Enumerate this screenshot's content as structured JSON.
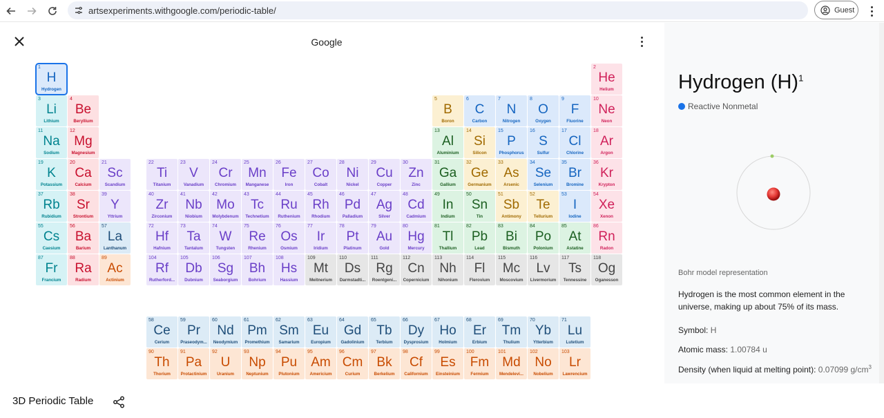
{
  "browser": {
    "url": "artsexperiments.withgoogle.com/periodic-table/",
    "profile_label": "Guest",
    "icons": [
      "back-icon",
      "forward-icon",
      "reload-icon",
      "site-info-icon",
      "profile-icon",
      "more-vert-icon"
    ]
  },
  "app": {
    "brand": "Google",
    "footer_title": "3D Periodic Table",
    "icons": [
      "close-icon",
      "more-vert-icon",
      "share-icon"
    ]
  },
  "colors": {
    "accent": "#1a73e8",
    "categories": {
      "reactive": {
        "bg": "#dbe9fb",
        "fg": "#1565c0"
      },
      "noble": {
        "bg": "#fde2e8",
        "fg": "#d0215a"
      },
      "alkali": {
        "bg": "#d5f2f5",
        "fg": "#00838f"
      },
      "alkaline": {
        "bg": "#fde0e2",
        "fg": "#c8102e"
      },
      "transition": {
        "bg": "#ece6fb",
        "fg": "#6a3fc8"
      },
      "posttransition": {
        "bg": "#dcf3e2",
        "fg": "#1b5e20"
      },
      "metalloid": {
        "bg": "#fcf0d2",
        "fg": "#a06a00"
      },
      "unknown": {
        "bg": "#e6e6e6",
        "fg": "#444444"
      },
      "lanthanide": {
        "bg": "#dcebf6",
        "fg": "#1f4e79"
      },
      "actinide": {
        "bg": "#fde6d4",
        "fg": "#c84b00"
      }
    }
  },
  "elements": [
    {
      "n": "1",
      "s": "H",
      "name": "Hydrogen",
      "c": "reactive",
      "r": 1,
      "g": 1
    },
    {
      "n": "2",
      "s": "He",
      "name": "Helium",
      "c": "noble",
      "r": 1,
      "g": 18
    },
    {
      "n": "3",
      "s": "Li",
      "name": "Lithium",
      "c": "alkali",
      "r": 2,
      "g": 1
    },
    {
      "n": "4",
      "s": "Be",
      "name": "Beryllium",
      "c": "alkaline",
      "r": 2,
      "g": 2
    },
    {
      "n": "5",
      "s": "B",
      "name": "Boron",
      "c": "metalloid",
      "r": 2,
      "g": 13
    },
    {
      "n": "6",
      "s": "C",
      "name": "Carbon",
      "c": "reactive",
      "r": 2,
      "g": 14
    },
    {
      "n": "7",
      "s": "N",
      "name": "Nitrogen",
      "c": "reactive",
      "r": 2,
      "g": 15
    },
    {
      "n": "8",
      "s": "O",
      "name": "Oxygen",
      "c": "reactive",
      "r": 2,
      "g": 16
    },
    {
      "n": "9",
      "s": "F",
      "name": "Fluorine",
      "c": "reactive",
      "r": 2,
      "g": 17
    },
    {
      "n": "10",
      "s": "Ne",
      "name": "Neon",
      "c": "noble",
      "r": 2,
      "g": 18
    },
    {
      "n": "11",
      "s": "Na",
      "name": "Sodium",
      "c": "alkali",
      "r": 3,
      "g": 1
    },
    {
      "n": "12",
      "s": "Mg",
      "name": "Magnesium",
      "c": "alkaline",
      "r": 3,
      "g": 2
    },
    {
      "n": "13",
      "s": "Al",
      "name": "Aluminium",
      "c": "posttransition",
      "r": 3,
      "g": 13
    },
    {
      "n": "14",
      "s": "Si",
      "name": "Silicon",
      "c": "metalloid",
      "r": 3,
      "g": 14
    },
    {
      "n": "15",
      "s": "P",
      "name": "Phosphorus",
      "c": "reactive",
      "r": 3,
      "g": 15
    },
    {
      "n": "16",
      "s": "S",
      "name": "Sulfur",
      "c": "reactive",
      "r": 3,
      "g": 16
    },
    {
      "n": "17",
      "s": "Cl",
      "name": "Chlorine",
      "c": "reactive",
      "r": 3,
      "g": 17
    },
    {
      "n": "18",
      "s": "Ar",
      "name": "Argon",
      "c": "noble",
      "r": 3,
      "g": 18
    },
    {
      "n": "19",
      "s": "K",
      "name": "Potassium",
      "c": "alkali",
      "r": 4,
      "g": 1
    },
    {
      "n": "20",
      "s": "Ca",
      "name": "Calcium",
      "c": "alkaline",
      "r": 4,
      "g": 2
    },
    {
      "n": "21",
      "s": "Sc",
      "name": "Scandium",
      "c": "transition",
      "r": 4,
      "g": 3
    },
    {
      "n": "22",
      "s": "Ti",
      "name": "Titanium",
      "c": "transition",
      "r": 4,
      "g": 4
    },
    {
      "n": "23",
      "s": "V",
      "name": "Vanadium",
      "c": "transition",
      "r": 4,
      "g": 5
    },
    {
      "n": "24",
      "s": "Cr",
      "name": "Chromium",
      "c": "transition",
      "r": 4,
      "g": 6
    },
    {
      "n": "25",
      "s": "Mn",
      "name": "Manganese",
      "c": "transition",
      "r": 4,
      "g": 7
    },
    {
      "n": "26",
      "s": "Fe",
      "name": "Iron",
      "c": "transition",
      "r": 4,
      "g": 8
    },
    {
      "n": "27",
      "s": "Co",
      "name": "Cobalt",
      "c": "transition",
      "r": 4,
      "g": 9
    },
    {
      "n": "28",
      "s": "Ni",
      "name": "Nickel",
      "c": "transition",
      "r": 4,
      "g": 10
    },
    {
      "n": "29",
      "s": "Cu",
      "name": "Copper",
      "c": "transition",
      "r": 4,
      "g": 11
    },
    {
      "n": "30",
      "s": "Zn",
      "name": "Zinc",
      "c": "transition",
      "r": 4,
      "g": 12
    },
    {
      "n": "31",
      "s": "Ga",
      "name": "Gallium",
      "c": "posttransition",
      "r": 4,
      "g": 13
    },
    {
      "n": "32",
      "s": "Ge",
      "name": "Germanium",
      "c": "metalloid",
      "r": 4,
      "g": 14
    },
    {
      "n": "33",
      "s": "As",
      "name": "Arsenic",
      "c": "metalloid",
      "r": 4,
      "g": 15
    },
    {
      "n": "34",
      "s": "Se",
      "name": "Selenium",
      "c": "reactive",
      "r": 4,
      "g": 16
    },
    {
      "n": "35",
      "s": "Br",
      "name": "Bromine",
      "c": "reactive",
      "r": 4,
      "g": 17
    },
    {
      "n": "36",
      "s": "Kr",
      "name": "Krypton",
      "c": "noble",
      "r": 4,
      "g": 18
    },
    {
      "n": "37",
      "s": "Rb",
      "name": "Rubidium",
      "c": "alkali",
      "r": 5,
      "g": 1
    },
    {
      "n": "38",
      "s": "Sr",
      "name": "Strontium",
      "c": "alkaline",
      "r": 5,
      "g": 2
    },
    {
      "n": "39",
      "s": "Y",
      "name": "Yttrium",
      "c": "transition",
      "r": 5,
      "g": 3
    },
    {
      "n": "40",
      "s": "Zr",
      "name": "Zirconium",
      "c": "transition",
      "r": 5,
      "g": 4
    },
    {
      "n": "41",
      "s": "Nb",
      "name": "Niobium",
      "c": "transition",
      "r": 5,
      "g": 5
    },
    {
      "n": "42",
      "s": "Mo",
      "name": "Molybdenum",
      "c": "transition",
      "r": 5,
      "g": 6
    },
    {
      "n": "43",
      "s": "Tc",
      "name": "Technetium",
      "c": "transition",
      "r": 5,
      "g": 7
    },
    {
      "n": "44",
      "s": "Ru",
      "name": "Ruthenium",
      "c": "transition",
      "r": 5,
      "g": 8
    },
    {
      "n": "45",
      "s": "Rh",
      "name": "Rhodium",
      "c": "transition",
      "r": 5,
      "g": 9
    },
    {
      "n": "46",
      "s": "Pd",
      "name": "Palladium",
      "c": "transition",
      "r": 5,
      "g": 10
    },
    {
      "n": "47",
      "s": "Ag",
      "name": "Silver",
      "c": "transition",
      "r": 5,
      "g": 11
    },
    {
      "n": "48",
      "s": "Cd",
      "name": "Cadmium",
      "c": "transition",
      "r": 5,
      "g": 12
    },
    {
      "n": "49",
      "s": "In",
      "name": "Indium",
      "c": "posttransition",
      "r": 5,
      "g": 13
    },
    {
      "n": "50",
      "s": "Sn",
      "name": "Tin",
      "c": "posttransition",
      "r": 5,
      "g": 14
    },
    {
      "n": "51",
      "s": "Sb",
      "name": "Antimony",
      "c": "metalloid",
      "r": 5,
      "g": 15
    },
    {
      "n": "52",
      "s": "Te",
      "name": "Tellurium",
      "c": "metalloid",
      "r": 5,
      "g": 16
    },
    {
      "n": "53",
      "s": "I",
      "name": "Iodine",
      "c": "reactive",
      "r": 5,
      "g": 17
    },
    {
      "n": "54",
      "s": "Xe",
      "name": "Xenon",
      "c": "noble",
      "r": 5,
      "g": 18
    },
    {
      "n": "55",
      "s": "Cs",
      "name": "Caesium",
      "c": "alkali",
      "r": 6,
      "g": 1
    },
    {
      "n": "56",
      "s": "Ba",
      "name": "Barium",
      "c": "alkaline",
      "r": 6,
      "g": 2
    },
    {
      "n": "57",
      "s": "La",
      "name": "Lanthanum",
      "c": "lanthanide",
      "r": 6,
      "g": 3
    },
    {
      "n": "72",
      "s": "Hf",
      "name": "Hafnium",
      "c": "transition",
      "r": 6,
      "g": 4
    },
    {
      "n": "73",
      "s": "Ta",
      "name": "Tantalum",
      "c": "transition",
      "r": 6,
      "g": 5
    },
    {
      "n": "74",
      "s": "W",
      "name": "Tungsten",
      "c": "transition",
      "r": 6,
      "g": 6
    },
    {
      "n": "75",
      "s": "Re",
      "name": "Rhenium",
      "c": "transition",
      "r": 6,
      "g": 7
    },
    {
      "n": "76",
      "s": "Os",
      "name": "Osmium",
      "c": "transition",
      "r": 6,
      "g": 8
    },
    {
      "n": "77",
      "s": "Ir",
      "name": "Iridium",
      "c": "transition",
      "r": 6,
      "g": 9
    },
    {
      "n": "78",
      "s": "Pt",
      "name": "Platinum",
      "c": "transition",
      "r": 6,
      "g": 10
    },
    {
      "n": "79",
      "s": "Au",
      "name": "Gold",
      "c": "transition",
      "r": 6,
      "g": 11
    },
    {
      "n": "80",
      "s": "Hg",
      "name": "Mercury",
      "c": "transition",
      "r": 6,
      "g": 12
    },
    {
      "n": "81",
      "s": "Tl",
      "name": "Thallium",
      "c": "posttransition",
      "r": 6,
      "g": 13
    },
    {
      "n": "82",
      "s": "Pb",
      "name": "Lead",
      "c": "posttransition",
      "r": 6,
      "g": 14
    },
    {
      "n": "83",
      "s": "Bi",
      "name": "Bismuth",
      "c": "posttransition",
      "r": 6,
      "g": 15
    },
    {
      "n": "84",
      "s": "Po",
      "name": "Polonium",
      "c": "posttransition",
      "r": 6,
      "g": 16
    },
    {
      "n": "85",
      "s": "At",
      "name": "Astatine",
      "c": "posttransition",
      "r": 6,
      "g": 17
    },
    {
      "n": "86",
      "s": "Rn",
      "name": "Radon",
      "c": "noble",
      "r": 6,
      "g": 18
    },
    {
      "n": "87",
      "s": "Fr",
      "name": "Francium",
      "c": "alkali",
      "r": 7,
      "g": 1
    },
    {
      "n": "88",
      "s": "Ra",
      "name": "Radium",
      "c": "alkaline",
      "r": 7,
      "g": 2
    },
    {
      "n": "89",
      "s": "Ac",
      "name": "Actinium",
      "c": "actinide",
      "r": 7,
      "g": 3
    },
    {
      "n": "104",
      "s": "Rf",
      "name": "Rutherford...",
      "c": "transition",
      "r": 7,
      "g": 4
    },
    {
      "n": "105",
      "s": "Db",
      "name": "Dubnium",
      "c": "transition",
      "r": 7,
      "g": 5
    },
    {
      "n": "106",
      "s": "Sg",
      "name": "Seaborgium",
      "c": "transition",
      "r": 7,
      "g": 6
    },
    {
      "n": "107",
      "s": "Bh",
      "name": "Bohrium",
      "c": "transition",
      "r": 7,
      "g": 7
    },
    {
      "n": "108",
      "s": "Hs",
      "name": "Hassium",
      "c": "transition",
      "r": 7,
      "g": 8
    },
    {
      "n": "109",
      "s": "Mt",
      "name": "Meitnerium",
      "c": "unknown",
      "r": 7,
      "g": 9
    },
    {
      "n": "110",
      "s": "Ds",
      "name": "Darmstadti...",
      "c": "unknown",
      "r": 7,
      "g": 10
    },
    {
      "n": "111",
      "s": "Rg",
      "name": "Roentgeni...",
      "c": "unknown",
      "r": 7,
      "g": 11
    },
    {
      "n": "112",
      "s": "Cn",
      "name": "Copernicium",
      "c": "unknown",
      "r": 7,
      "g": 12
    },
    {
      "n": "113",
      "s": "Nh",
      "name": "Nihonium",
      "c": "unknown",
      "r": 7,
      "g": 13
    },
    {
      "n": "114",
      "s": "Fl",
      "name": "Flerovium",
      "c": "unknown",
      "r": 7,
      "g": 14
    },
    {
      "n": "115",
      "s": "Mc",
      "name": "Moscovium",
      "c": "unknown",
      "r": 7,
      "g": 15
    },
    {
      "n": "116",
      "s": "Lv",
      "name": "Livermorium",
      "c": "unknown",
      "r": 7,
      "g": 16
    },
    {
      "n": "117",
      "s": "Ts",
      "name": "Tennessine",
      "c": "unknown",
      "r": 7,
      "g": 17
    },
    {
      "n": "118",
      "s": "Og",
      "name": "Oganesson",
      "c": "unknown",
      "r": 7,
      "g": 18
    },
    {
      "n": "58",
      "s": "Ce",
      "name": "Cerium",
      "c": "lanthanide",
      "r": 9,
      "g": 4
    },
    {
      "n": "59",
      "s": "Pr",
      "name": "Praseodym...",
      "c": "lanthanide",
      "r": 9,
      "g": 5
    },
    {
      "n": "60",
      "s": "Nd",
      "name": "Neodymium",
      "c": "lanthanide",
      "r": 9,
      "g": 6
    },
    {
      "n": "61",
      "s": "Pm",
      "name": "Promethium",
      "c": "lanthanide",
      "r": 9,
      "g": 7
    },
    {
      "n": "62",
      "s": "Sm",
      "name": "Samarium",
      "c": "lanthanide",
      "r": 9,
      "g": 8
    },
    {
      "n": "63",
      "s": "Eu",
      "name": "Europium",
      "c": "lanthanide",
      "r": 9,
      "g": 9
    },
    {
      "n": "64",
      "s": "Gd",
      "name": "Gadolinium",
      "c": "lanthanide",
      "r": 9,
      "g": 10
    },
    {
      "n": "65",
      "s": "Tb",
      "name": "Terbium",
      "c": "lanthanide",
      "r": 9,
      "g": 11
    },
    {
      "n": "66",
      "s": "Dy",
      "name": "Dysprosium",
      "c": "lanthanide",
      "r": 9,
      "g": 12
    },
    {
      "n": "67",
      "s": "Ho",
      "name": "Holmium",
      "c": "lanthanide",
      "r": 9,
      "g": 13
    },
    {
      "n": "68",
      "s": "Er",
      "name": "Erbium",
      "c": "lanthanide",
      "r": 9,
      "g": 14
    },
    {
      "n": "69",
      "s": "Tm",
      "name": "Thulium",
      "c": "lanthanide",
      "r": 9,
      "g": 15
    },
    {
      "n": "70",
      "s": "Yb",
      "name": "Ytterbium",
      "c": "lanthanide",
      "r": 9,
      "g": 16
    },
    {
      "n": "71",
      "s": "Lu",
      "name": "Lutetium",
      "c": "lanthanide",
      "r": 9,
      "g": 17
    },
    {
      "n": "90",
      "s": "Th",
      "name": "Thorium",
      "c": "actinide",
      "r": 10,
      "g": 4
    },
    {
      "n": "91",
      "s": "Pa",
      "name": "Protactinium",
      "c": "actinide",
      "r": 10,
      "g": 5
    },
    {
      "n": "92",
      "s": "U",
      "name": "Uranium",
      "c": "actinide",
      "r": 10,
      "g": 6
    },
    {
      "n": "93",
      "s": "Np",
      "name": "Neptunium",
      "c": "actinide",
      "r": 10,
      "g": 7
    },
    {
      "n": "94",
      "s": "Pu",
      "name": "Plutonium",
      "c": "actinide",
      "r": 10,
      "g": 8
    },
    {
      "n": "95",
      "s": "Am",
      "name": "Americium",
      "c": "actinide",
      "r": 10,
      "g": 9
    },
    {
      "n": "96",
      "s": "Cm",
      "name": "Curium",
      "c": "actinide",
      "r": 10,
      "g": 10
    },
    {
      "n": "97",
      "s": "Bk",
      "name": "Berkelium",
      "c": "actinide",
      "r": 10,
      "g": 11
    },
    {
      "n": "98",
      "s": "Cf",
      "name": "Californium",
      "c": "actinide",
      "r": 10,
      "g": 12
    },
    {
      "n": "99",
      "s": "Es",
      "name": "Einsteinium",
      "c": "actinide",
      "r": 10,
      "g": 13
    },
    {
      "n": "100",
      "s": "Fm",
      "name": "Fermium",
      "c": "actinide",
      "r": 10,
      "g": 14
    },
    {
      "n": "101",
      "s": "Md",
      "name": "Mendelevi...",
      "c": "actinide",
      "r": 10,
      "g": 15
    },
    {
      "n": "102",
      "s": "No",
      "name": "Nobelium",
      "c": "actinide",
      "r": 10,
      "g": 16
    },
    {
      "n": "103",
      "s": "Lr",
      "name": "Lawrencium",
      "c": "actinide",
      "r": 10,
      "g": 17
    }
  ],
  "selected": {
    "symbol_index": "1",
    "title": "Hydrogen (H)",
    "atomic_number": "1",
    "category": "Reactive Nonmetal",
    "bohr_caption": "Bohr model representation",
    "description": "Hydrogen is the most common element in the universe, making up about 75% of its mass.",
    "symbol_label": "Symbol:",
    "symbol_value": "H",
    "mass_label": "Atomic mass:",
    "mass_value": "1.00784 u",
    "density_label": "Density (when liquid at melting point):",
    "density_value": "0.07099 g/cm",
    "density_unit_sup": "3"
  }
}
